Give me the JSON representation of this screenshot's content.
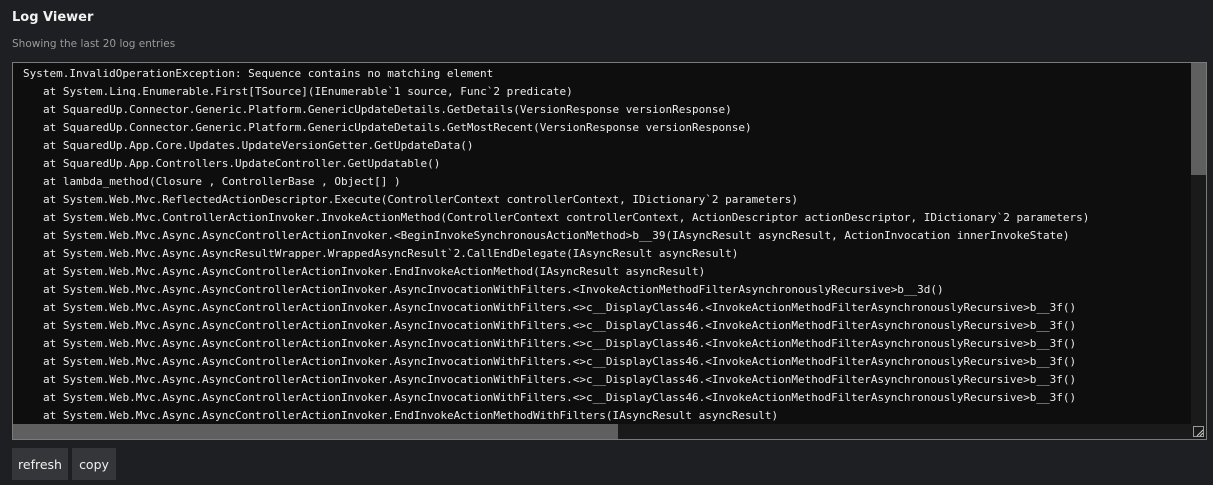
{
  "header": {
    "title": "Log Viewer",
    "subtitle": "Showing the last 20 log entries"
  },
  "log": {
    "lines": [
      {
        "text": "System.InvalidOperationException: Sequence contains no matching element",
        "indent": false
      },
      {
        "text": "at System.Linq.Enumerable.First[TSource](IEnumerable`1 source, Func`2 predicate)",
        "indent": true
      },
      {
        "text": "at SquaredUp.Connector.Generic.Platform.GenericUpdateDetails.GetDetails(VersionResponse versionResponse)",
        "indent": true
      },
      {
        "text": "at SquaredUp.Connector.Generic.Platform.GenericUpdateDetails.GetMostRecent(VersionResponse versionResponse)",
        "indent": true
      },
      {
        "text": "at SquaredUp.App.Core.Updates.UpdateVersionGetter.GetUpdateData()",
        "indent": true
      },
      {
        "text": "at SquaredUp.App.Controllers.UpdateController.GetUpdatable()",
        "indent": true
      },
      {
        "text": "at lambda_method(Closure , ControllerBase , Object[] )",
        "indent": true
      },
      {
        "text": "at System.Web.Mvc.ReflectedActionDescriptor.Execute(ControllerContext controllerContext, IDictionary`2 parameters)",
        "indent": true
      },
      {
        "text": "at System.Web.Mvc.ControllerActionInvoker.InvokeActionMethod(ControllerContext controllerContext, ActionDescriptor actionDescriptor, IDictionary`2 parameters)",
        "indent": true
      },
      {
        "text": "at System.Web.Mvc.Async.AsyncControllerActionInvoker.<BeginInvokeSynchronousActionMethod>b__39(IAsyncResult asyncResult, ActionInvocation innerInvokeState)",
        "indent": true
      },
      {
        "text": "at System.Web.Mvc.Async.AsyncResultWrapper.WrappedAsyncResult`2.CallEndDelegate(IAsyncResult asyncResult)",
        "indent": true
      },
      {
        "text": "at System.Web.Mvc.Async.AsyncControllerActionInvoker.EndInvokeActionMethod(IAsyncResult asyncResult)",
        "indent": true
      },
      {
        "text": "at System.Web.Mvc.Async.AsyncControllerActionInvoker.AsyncInvocationWithFilters.<InvokeActionMethodFilterAsynchronouslyRecursive>b__3d()",
        "indent": true
      },
      {
        "text": "at System.Web.Mvc.Async.AsyncControllerActionInvoker.AsyncInvocationWithFilters.<>c__DisplayClass46.<InvokeActionMethodFilterAsynchronouslyRecursive>b__3f()",
        "indent": true
      },
      {
        "text": "at System.Web.Mvc.Async.AsyncControllerActionInvoker.AsyncInvocationWithFilters.<>c__DisplayClass46.<InvokeActionMethodFilterAsynchronouslyRecursive>b__3f()",
        "indent": true
      },
      {
        "text": "at System.Web.Mvc.Async.AsyncControllerActionInvoker.AsyncInvocationWithFilters.<>c__DisplayClass46.<InvokeActionMethodFilterAsynchronouslyRecursive>b__3f()",
        "indent": true
      },
      {
        "text": "at System.Web.Mvc.Async.AsyncControllerActionInvoker.AsyncInvocationWithFilters.<>c__DisplayClass46.<InvokeActionMethodFilterAsynchronouslyRecursive>b__3f()",
        "indent": true
      },
      {
        "text": "at System.Web.Mvc.Async.AsyncControllerActionInvoker.AsyncInvocationWithFilters.<>c__DisplayClass46.<InvokeActionMethodFilterAsynchronouslyRecursive>b__3f()",
        "indent": true
      },
      {
        "text": "at System.Web.Mvc.Async.AsyncControllerActionInvoker.AsyncInvocationWithFilters.<>c__DisplayClass46.<InvokeActionMethodFilterAsynchronouslyRecursive>b__3f()",
        "indent": true
      },
      {
        "text": "at System.Web.Mvc.Async.AsyncControllerActionInvoker.EndInvokeActionMethodWithFilters(IAsyncResult asyncResult)",
        "indent": true
      }
    ]
  },
  "buttons": {
    "refresh_label": "refresh",
    "copy_label": "copy"
  },
  "icons": {
    "resize": "resize-grip-icon"
  },
  "colors": {
    "background": "#1e1f22",
    "log_background": "#0e0e0e",
    "button_background": "#35363a",
    "scroll_thumb": "#5f5f5f"
  }
}
